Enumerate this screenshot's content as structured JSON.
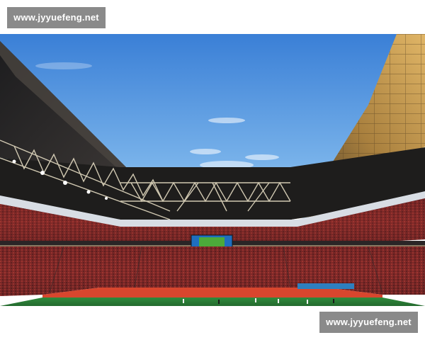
{
  "watermark_top": {
    "text": "www.jyyuefeng.net"
  },
  "watermark_bottom": {
    "text": "www.jyyuefeng.net"
  },
  "photo": {
    "subject": "stadium-interior",
    "colors": {
      "sky_top": "#3f86d9",
      "sky_bottom": "#9cc8ee",
      "roof_dark": "#2a2a2a",
      "roof_lit": "#c89a4a",
      "truss": "#e8e0c8",
      "crowd": "#8a2a2a",
      "pitch": "#2f7a3a",
      "screen": "#2a8fd0"
    }
  }
}
